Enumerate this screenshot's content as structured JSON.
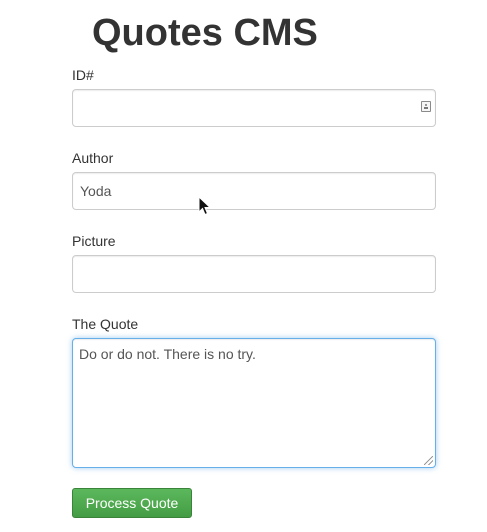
{
  "page": {
    "title": "Quotes CMS"
  },
  "form": {
    "id_field": {
      "label": "ID#",
      "value": "",
      "icon": "contact-card-icon"
    },
    "author_field": {
      "label": "Author",
      "value": "Yoda"
    },
    "picture_field": {
      "label": "Picture",
      "value": ""
    },
    "quote_field": {
      "label": "The Quote",
      "value": "Do or do not. There is no try."
    },
    "submit_label": "Process Quote"
  },
  "colors": {
    "submit_button": "#5cb85c",
    "focus_border": "#66afe9",
    "text": "#333333"
  }
}
